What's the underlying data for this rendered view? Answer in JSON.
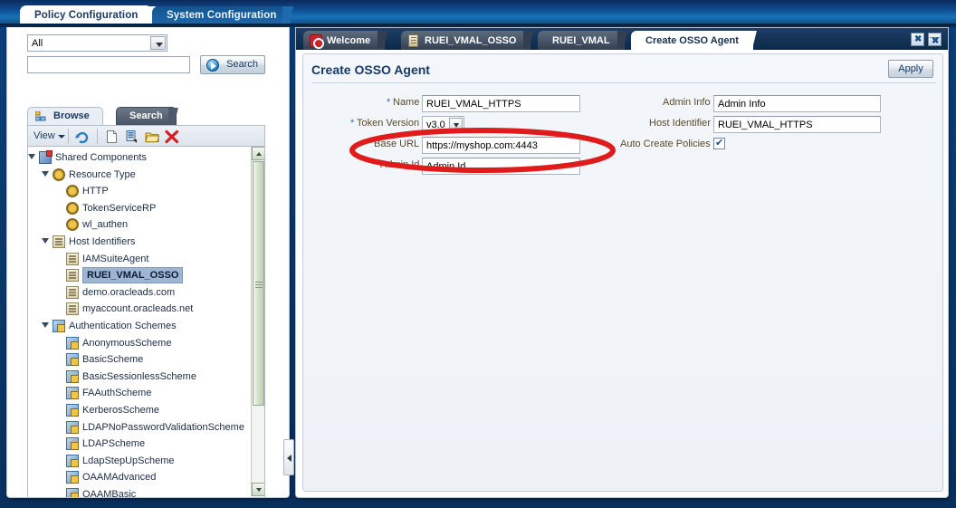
{
  "header": {
    "tabs": [
      {
        "label": "Policy Configuration",
        "active": true
      },
      {
        "label": "System Configuration",
        "active": false
      }
    ]
  },
  "left_panel": {
    "filter_select": {
      "value": "All",
      "icon": "chevron-down-icon"
    },
    "search_input": {
      "value": "",
      "placeholder": ""
    },
    "search_button": {
      "label": "Search",
      "icon": "search-go-icon"
    },
    "subtabs": [
      {
        "label": "Browse",
        "active": true,
        "icon": "browse-tree-icon"
      },
      {
        "label": "Search",
        "active": false
      }
    ],
    "toolbar": {
      "view_menu": "View",
      "icons": [
        "refresh-icon",
        "new-document-icon",
        "duplicate-icon",
        "open-folder-icon",
        "delete-icon"
      ]
    },
    "tree": [
      {
        "label": "Shared Components",
        "depth": 0,
        "icon": "shared-components-icon",
        "expanded": true,
        "selected": false
      },
      {
        "label": "Resource Type",
        "depth": 1,
        "icon": "gear-icon",
        "expanded": true,
        "selected": false
      },
      {
        "label": "HTTP",
        "depth": 2,
        "icon": "gear-icon",
        "expanded": null,
        "selected": false
      },
      {
        "label": "TokenServiceRP",
        "depth": 2,
        "icon": "gear-icon",
        "expanded": null,
        "selected": false
      },
      {
        "label": "wl_authen",
        "depth": 2,
        "icon": "gear-icon",
        "expanded": null,
        "selected": false
      },
      {
        "label": "Host Identifiers",
        "depth": 1,
        "icon": "host-identifier-icon",
        "expanded": true,
        "selected": false
      },
      {
        "label": "IAMSuiteAgent",
        "depth": 2,
        "icon": "host-identifier-icon",
        "expanded": null,
        "selected": false
      },
      {
        "label": "RUEI_VMAL_OSSO",
        "depth": 2,
        "icon": "host-identifier-icon",
        "expanded": null,
        "selected": true
      },
      {
        "label": "demo.oracleads.com",
        "depth": 2,
        "icon": "host-identifier-icon",
        "expanded": null,
        "selected": false
      },
      {
        "label": "myaccount.oracleads.net",
        "depth": 2,
        "icon": "host-identifier-icon",
        "expanded": null,
        "selected": false
      },
      {
        "label": "Authentication Schemes",
        "depth": 1,
        "icon": "auth-scheme-icon",
        "expanded": true,
        "selected": false
      },
      {
        "label": "AnonymousScheme",
        "depth": 2,
        "icon": "auth-scheme-icon",
        "expanded": null,
        "selected": false
      },
      {
        "label": "BasicScheme",
        "depth": 2,
        "icon": "auth-scheme-icon",
        "expanded": null,
        "selected": false
      },
      {
        "label": "BasicSessionlessScheme",
        "depth": 2,
        "icon": "auth-scheme-icon",
        "expanded": null,
        "selected": false
      },
      {
        "label": "FAAuthScheme",
        "depth": 2,
        "icon": "auth-scheme-icon",
        "expanded": null,
        "selected": false
      },
      {
        "label": "KerberosScheme",
        "depth": 2,
        "icon": "auth-scheme-icon",
        "expanded": null,
        "selected": false
      },
      {
        "label": "LDAPNoPasswordValidationScheme",
        "depth": 2,
        "icon": "auth-scheme-icon",
        "expanded": null,
        "selected": false
      },
      {
        "label": "LDAPScheme",
        "depth": 2,
        "icon": "auth-scheme-icon",
        "expanded": null,
        "selected": false
      },
      {
        "label": "LdapStepUpScheme",
        "depth": 2,
        "icon": "auth-scheme-icon",
        "expanded": null,
        "selected": false
      },
      {
        "label": "OAAMAdvanced",
        "depth": 2,
        "icon": "auth-scheme-icon",
        "expanded": null,
        "selected": false
      },
      {
        "label": "OAAMBasic",
        "depth": 2,
        "icon": "auth-scheme-icon",
        "expanded": null,
        "selected": false
      }
    ]
  },
  "right_panel": {
    "tabs": [
      {
        "label": "Welcome",
        "active": false,
        "icon": "oracle-logo-icon"
      },
      {
        "label": "RUEI_VMAL_OSSO",
        "active": false,
        "icon": "host-identifier-icon"
      },
      {
        "label": "RUEI_VMAL",
        "active": false,
        "icon": null
      },
      {
        "label": "Create OSSO Agent",
        "active": true,
        "icon": null
      }
    ],
    "window_buttons": [
      "close-icon",
      "restore-icon"
    ],
    "page_title": "Create OSSO Agent",
    "apply_button": "Apply",
    "form": {
      "left_fields": [
        {
          "label": "Name",
          "required": true,
          "type": "text",
          "value": "RUEI_VMAL_HTTPS"
        },
        {
          "label": "Token Version",
          "required": true,
          "type": "select",
          "value": "v3.0"
        },
        {
          "label": "Base URL",
          "required": true,
          "type": "text",
          "value": "https://myshop.com:4443"
        },
        {
          "label": "Admin Id",
          "required": false,
          "type": "text",
          "value": "Admin Id"
        }
      ],
      "right_fields": [
        {
          "label": "Admin Info",
          "required": false,
          "type": "text",
          "value": "Admin Info"
        },
        {
          "label": "Host Identifier",
          "required": false,
          "type": "text",
          "value": "RUEI_VMAL_HTTPS"
        },
        {
          "label": "Auto Create Policies",
          "required": false,
          "type": "checkbox",
          "value": "checked"
        }
      ]
    }
  },
  "annotation": {
    "shape": "ellipse",
    "color": "#e01b1b",
    "target": "Base URL"
  },
  "colors": {
    "header_blue": "#0f4e92",
    "accent_blue": "#1b3a63",
    "selection": "#9eb6d4",
    "annotation_red": "#e01b1b",
    "label_brown": "#5a4a2a"
  }
}
